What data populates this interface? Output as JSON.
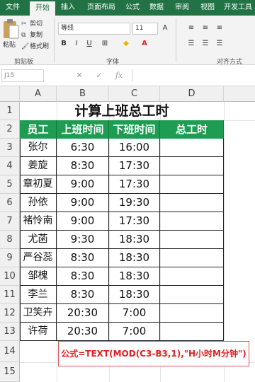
{
  "ribbon_tabs": [
    "文件",
    "开始",
    "插入",
    "页面布局",
    "公式",
    "数据",
    "审阅",
    "视图",
    "开发工具"
  ],
  "clipboard": {
    "paste_label": "粘贴",
    "cut_label": "剪切",
    "copy_label": "复制",
    "format_painter_label": "格式刷",
    "group_label": "剪贴板"
  },
  "font": {
    "font_name": "等线",
    "font_size": "11",
    "group_label": "字体",
    "bold": "B",
    "italic": "I",
    "underline": "U"
  },
  "alignment": {
    "group_label": "对齐方式"
  },
  "formula_bar": {
    "name_box": "J15",
    "fx": "fx",
    "cancel": "✕",
    "confirm": "✓",
    "formula": ""
  },
  "columns": [
    "A",
    "B",
    "C",
    "D"
  ],
  "rows": [
    "1",
    "2",
    "3",
    "4",
    "5",
    "6",
    "7",
    "8",
    "9",
    "10",
    "11",
    "12",
    "13",
    "14",
    "15"
  ],
  "sheet": {
    "title": "计算上班总工时",
    "headers": [
      "员工",
      "上班时间",
      "下班时间",
      "总工时"
    ],
    "records": [
      {
        "name": "张尔",
        "start": "6:30",
        "end": "16:00",
        "total": ""
      },
      {
        "name": "姜旋",
        "start": "8:30",
        "end": "17:30",
        "total": ""
      },
      {
        "name": "章初夏",
        "start": "9:00",
        "end": "17:30",
        "total": ""
      },
      {
        "name": "孙依",
        "start": "9:00",
        "end": "19:30",
        "total": ""
      },
      {
        "name": "褚怜南",
        "start": "9:00",
        "end": "17:30",
        "total": ""
      },
      {
        "name": "尤菡",
        "start": "9:30",
        "end": "18:30",
        "total": ""
      },
      {
        "name": "严谷蕊",
        "start": "8:30",
        "end": "18:30",
        "total": ""
      },
      {
        "name": "邹槐",
        "start": "8:30",
        "end": "18:30",
        "total": ""
      },
      {
        "name": "李兰",
        "start": "8:30",
        "end": "18:30",
        "total": ""
      },
      {
        "name": "卫笑卉",
        "start": "20:30",
        "end": "7:00",
        "total": ""
      },
      {
        "name": "许荷",
        "start": "20:30",
        "end": "7:00",
        "total": ""
      }
    ],
    "formula_note": "公式=TEXT(MOD(C3-B3,1),\"H小时M分钟\")"
  },
  "colors": {
    "ribbon_green": "#217346",
    "header_green": "#1e9c52",
    "note_red": "#e02020"
  }
}
